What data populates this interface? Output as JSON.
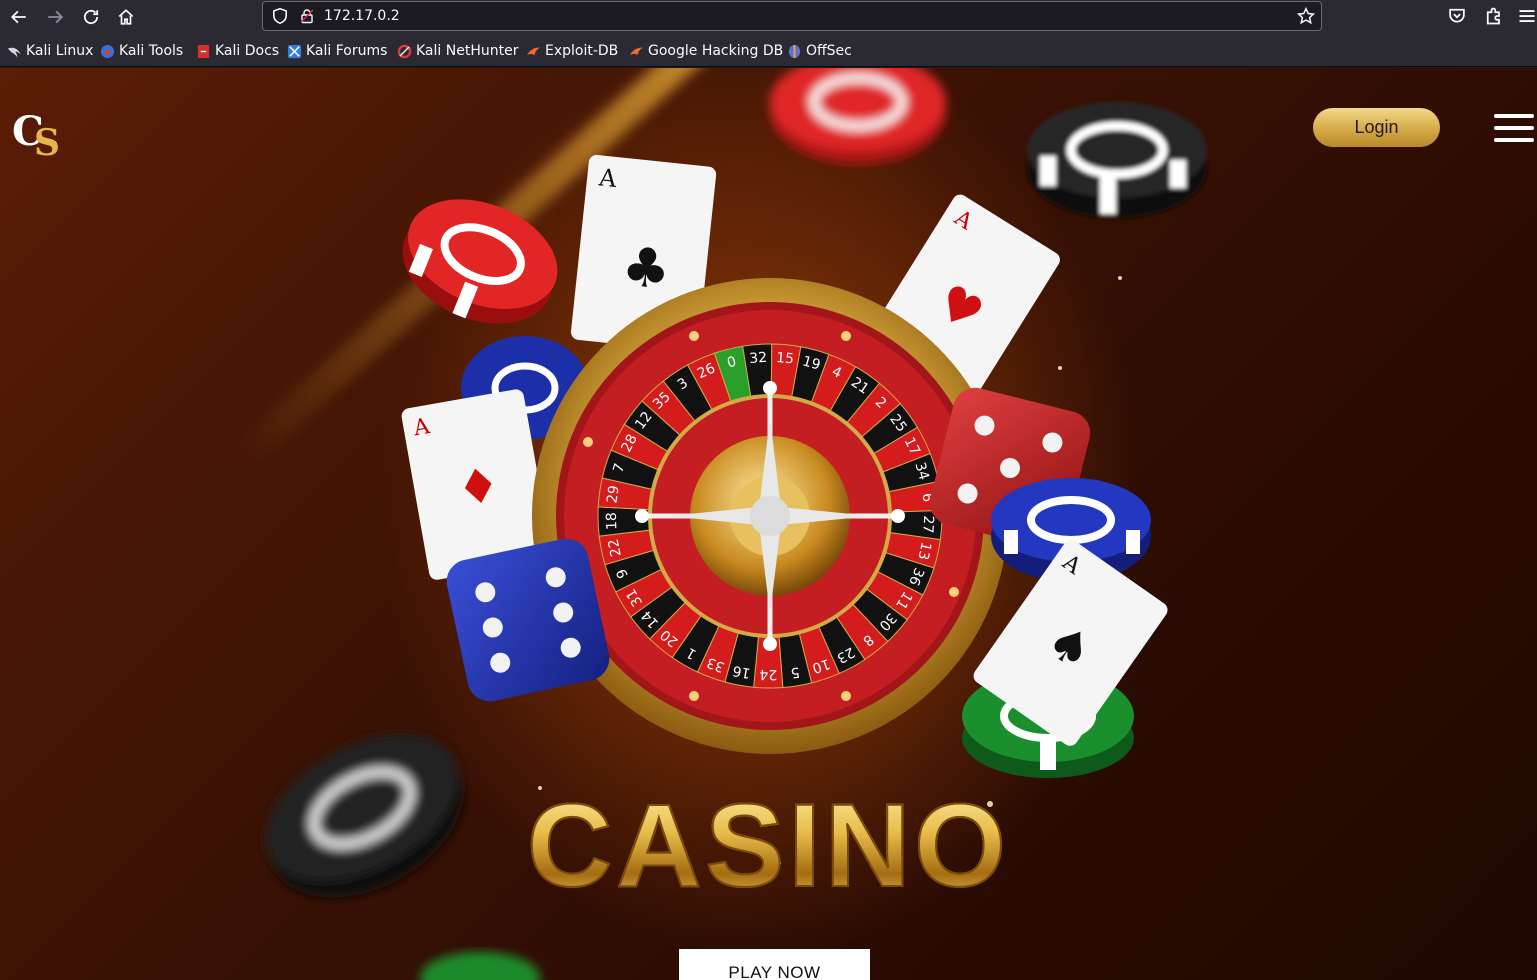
{
  "browser": {
    "url": "172.17.0.2",
    "bookmarks": [
      {
        "label": "Kali Linux",
        "icon": "kali-dragon-icon"
      },
      {
        "label": "Kali Tools",
        "icon": "kali-tools-icon"
      },
      {
        "label": "Kali Docs",
        "icon": "kali-docs-icon"
      },
      {
        "label": "Kali Forums",
        "icon": "kali-forums-icon"
      },
      {
        "label": "Kali NetHunter",
        "icon": "kali-nethunter-icon"
      },
      {
        "label": "Exploit-DB",
        "icon": "exploit-db-icon"
      },
      {
        "label": "Google Hacking DB",
        "icon": "ghdb-icon"
      },
      {
        "label": "OffSec",
        "icon": "offsec-icon"
      }
    ]
  },
  "site": {
    "logo_c": "C",
    "logo_s": "S",
    "login_label": "Login",
    "hero_title": "CASINO",
    "play_label": "PLAY NOW",
    "roulette_numbers": [
      "0",
      "32",
      "15",
      "19",
      "4",
      "21",
      "2",
      "25",
      "17",
      "34",
      "6",
      "27",
      "13",
      "36",
      "11",
      "30",
      "8",
      "23",
      "10",
      "5",
      "24",
      "16",
      "33",
      "1",
      "20",
      "14",
      "31",
      "9",
      "22",
      "18",
      "29",
      "7",
      "28",
      "12",
      "35",
      "3",
      "26"
    ],
    "cards": [
      {
        "rank": "A",
        "suit": "♣"
      },
      {
        "rank": "A",
        "suit": "♥"
      },
      {
        "rank": "A",
        "suit": "♦"
      },
      {
        "rank": "A",
        "suit": "♠"
      }
    ]
  },
  "colors": {
    "gold": "#d4a947",
    "chrome_bg": "#2b2a33"
  }
}
